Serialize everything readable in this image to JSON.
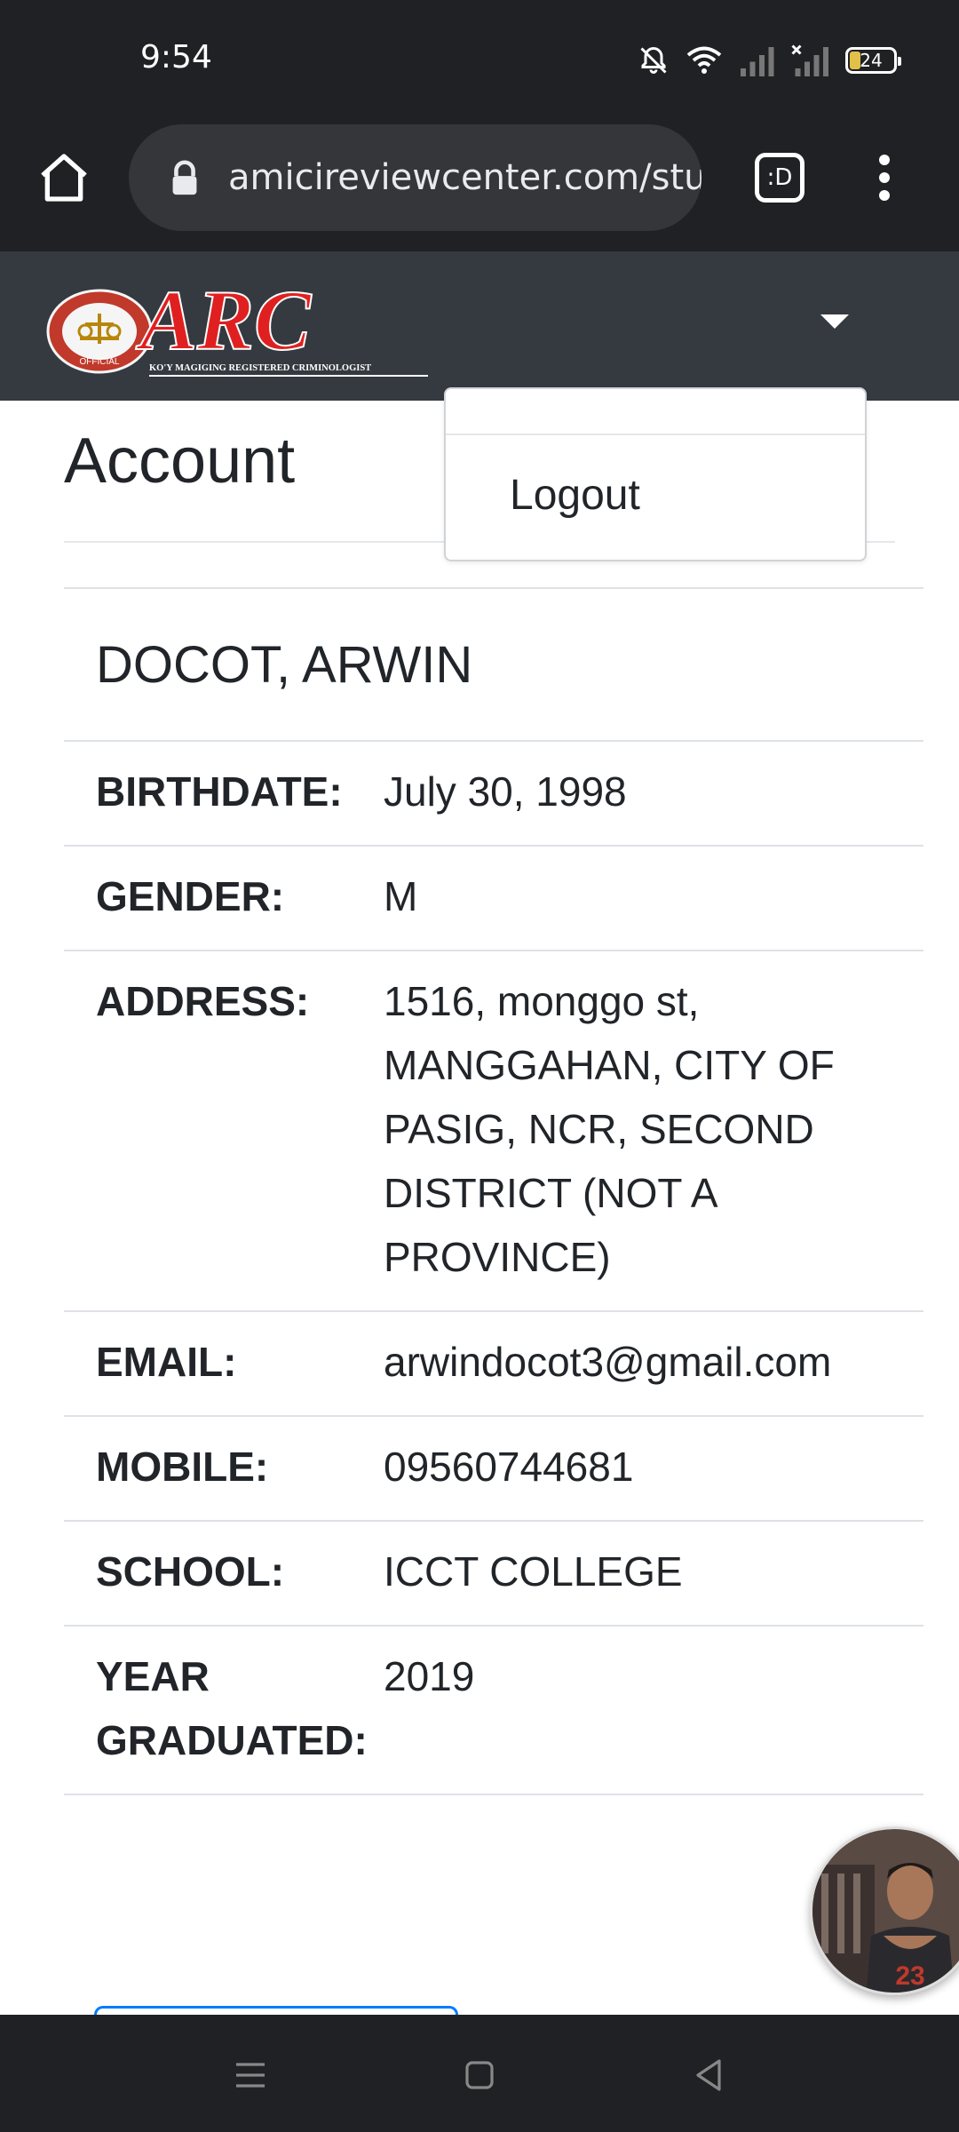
{
  "status_bar": {
    "time": "9:54",
    "battery": "24"
  },
  "browser": {
    "url": "amicireviewcenter.com/stu",
    "tab_label": ":D"
  },
  "navbar": {
    "logo": {
      "main": "ARC",
      "tagline": "KO'Y MAGIGING REGISTERED CRIMINOLOGIST",
      "seal": "OFFICIAL"
    }
  },
  "dropdown": {
    "items": [
      {
        "label": "Logout"
      }
    ]
  },
  "page": {
    "title": "Account"
  },
  "profile": {
    "name": "DOCOT, ARWIN",
    "rows": [
      {
        "label": "BIRTHDATE:",
        "value": "July 30, 1998"
      },
      {
        "label": "GENDER:",
        "value": "M"
      },
      {
        "label": "ADDRESS:",
        "value": "1516, monggo st, MANGGAHAN, CITY OF PASIG, NCR, SECOND DISTRICT (NOT A PROVINCE)"
      },
      {
        "label": "EMAIL:",
        "value": "arwindocot3@gmail.com"
      },
      {
        "label": "MOBILE:",
        "value": "09560744681"
      },
      {
        "label": "SCHOOL:",
        "value": "ICCT COLLEGE"
      },
      {
        "label": "YEAR GRADUATED:",
        "value": "2019"
      }
    ]
  },
  "colors": {
    "navbar": "#343a40",
    "chrome": "#202124",
    "accent": "#007bff",
    "logo_red": "#e02020"
  }
}
